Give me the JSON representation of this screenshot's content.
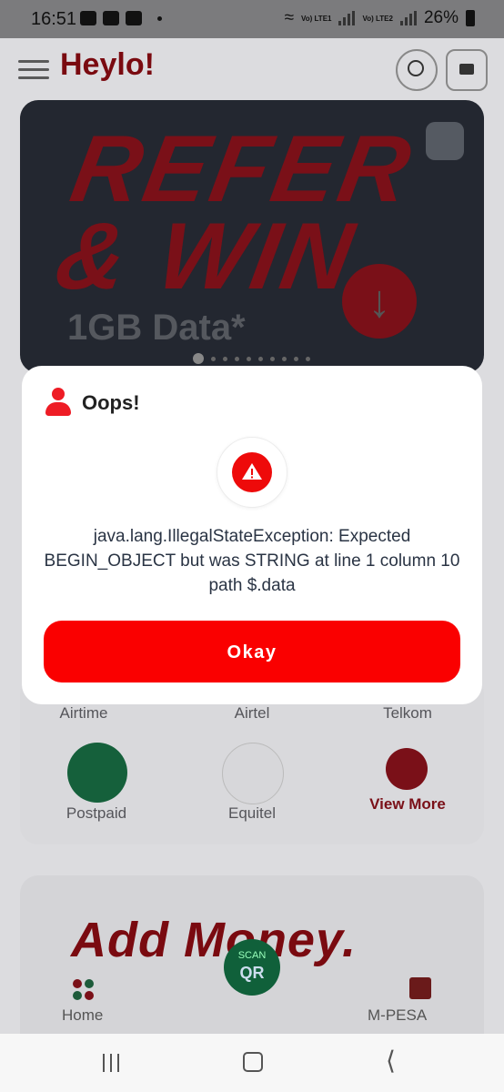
{
  "status_bar": {
    "time": "16:51",
    "sim1": "Vo) LTE1",
    "sim2": "Vo) LTE2",
    "battery": "26%"
  },
  "app": {
    "name": "Heylo!",
    "banner": {
      "headline": "REFER & WIN",
      "subline": "1GB Data*"
    },
    "services": {
      "row1": [
        "Airtime",
        "Airtel",
        "Telkom"
      ],
      "row2": [
        "Postpaid",
        "Equitel",
        "View More"
      ]
    },
    "promo_text": "Add Money.",
    "scan": {
      "line1": "SCAN",
      "line2": "QR"
    },
    "nav": {
      "home": "Home",
      "mpesa": "M-PESA"
    }
  },
  "dialog": {
    "title": "Oops!",
    "message": "java.lang.IllegalStateException: Expected BEGIN_OBJECT but was STRING at line 1 column 10 path $.data",
    "button": "Okay"
  },
  "colors": {
    "accent": "#fa0000",
    "warning": "#ee0a0a",
    "text": "#2a3444"
  }
}
